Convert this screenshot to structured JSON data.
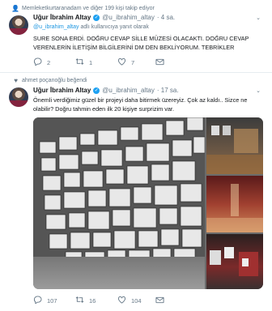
{
  "context": {
    "text": "Memleketkurtaranadam ve diğer 199 kişi takip ediyor"
  },
  "tweet1": {
    "name": "Uğur İbrahim Altay",
    "handle": "@u_ibrahim_altay",
    "time": "· 4 sa.",
    "reply_prefix": "@u_ibrahim_altay",
    "reply_suffix": " adlı kullanıcıya yanıt olarak",
    "text": "SURE SONA ERDİ. DOĞRU CEVAP SİLLE MÜZESİ OLACAKTI. DOĞRU CEVAP VERENLERİN İLETİŞİM BİLGİLERİNİ DM DEN BEKLİYORUM. TEBRİKLER",
    "replies": "2",
    "retweets": "1",
    "likes": "7"
  },
  "liked_context": {
    "text": "ahmet poçanoğlu beğendi"
  },
  "tweet2": {
    "name": "Uğur İbrahim Altay",
    "handle": "@u_ibrahim_altay",
    "time": "· 17 sa.",
    "text": "Önemli verdiğimiz güzel bir projeyi daha bitirmek üzereyiz. Çok az kaldı.. Sizce ne olabilir? Doğru tahmin eden ilk 20 kişiye surprizim var.",
    "replies": "107",
    "retweets": "16",
    "likes": "104"
  },
  "icons": {
    "accent": "#1da1f2",
    "muted": "#657786",
    "names": [
      "follow-icon",
      "verified-icon",
      "caret-down-icon",
      "reply-icon",
      "retweet-icon",
      "like-icon",
      "mail-icon"
    ]
  }
}
